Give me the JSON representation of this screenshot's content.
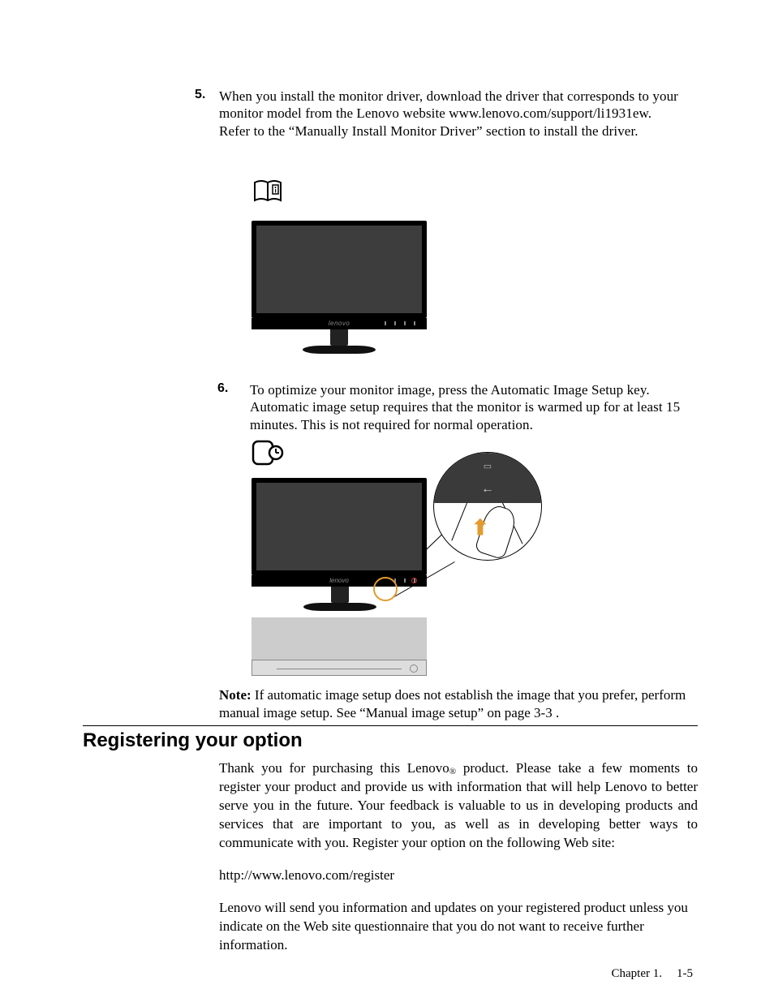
{
  "step5": {
    "number": "5.",
    "text_a": "When you install the monitor driver, download the driver that corresponds to your monitor model from the Lenovo website www.lenovo.com/support/li1931ew.",
    "text_b": "Refer to the “Manually Install Monitor Driver” section to install the driver."
  },
  "fig1": {
    "logo": "lenovo"
  },
  "step6": {
    "number": "6.",
    "text": "To optimize your monitor image, press the Automatic Image Setup key. Automatic image setup requires that the monitor is warmed up for at least 15 minutes. This is not required for normal operation."
  },
  "fig2": {
    "logo": "lenovo",
    "arrowleft": "←",
    "icon": "▭",
    "press": "⬆"
  },
  "note": {
    "label": "Note:",
    "text": " If automatic image setup does not establish the image that you prefer, perform manual image setup. See “Manual image setup” on page 3-3 ."
  },
  "heading": "Registering your option",
  "register": {
    "p1_a": "Thank you for purchasing this Lenovo",
    "reg": "®",
    "p1_b": " product. Please take a few moments to register your product and provide us with information that will help Lenovo to better serve you in the future. Your feedback is valuable to us in developing products and services that are important to you, as well as in developing better ways to communicate with you. Register your option on the following Web site:",
    "url": "http://www.lenovo.com/register",
    "p2": "Lenovo will send you information and updates on your registered product unless you indicate on the Web site questionnaire that you do not want to receive further information."
  },
  "footer": {
    "chapter": "Chapter 1.",
    "page": "1-5"
  }
}
